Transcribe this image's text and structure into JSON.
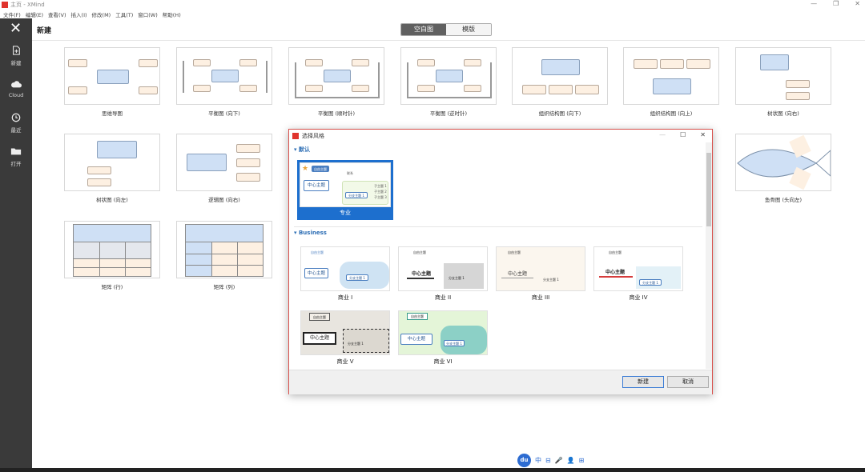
{
  "window": {
    "title": "主页 - XMind",
    "controls": [
      "—",
      "❐",
      "✕"
    ]
  },
  "menu": [
    "文件(F)",
    "编辑(E)",
    "查看(V)",
    "插入(I)",
    "修改(M)",
    "工具(T)",
    "窗口(W)",
    "帮助(H)"
  ],
  "sidebar": {
    "close": "✕",
    "items": [
      {
        "label": "新建",
        "icon": "new-file-icon"
      },
      {
        "label": "Cloud",
        "icon": "cloud-icon"
      },
      {
        "label": "最近",
        "icon": "clock-icon"
      },
      {
        "label": "打开",
        "icon": "folder-icon"
      }
    ]
  },
  "header": {
    "title": "新建",
    "tabs": [
      "空白图",
      "模版"
    ],
    "active_tab": 0
  },
  "templates": [
    "思维导图",
    "平衡图 (向下)",
    "平衡图 (顺时针)",
    "平衡图 (逆时针)",
    "组织结构图 (向下)",
    "组织结构图 (向上)",
    "树状图 (向右)",
    "树状图 (向左)",
    "逻辑图 (向右)",
    "鱼骨图 (头向左)",
    "矩阵 (行)",
    "矩阵 (列)"
  ],
  "dialog": {
    "title": "选择风格",
    "controls": [
      "—",
      "☐",
      "✕"
    ],
    "section_default": "默认",
    "section_business": "Business",
    "default_style": {
      "name": "专业",
      "center": "中心主题",
      "float": "自由主题",
      "branch": "分支主题 1",
      "subs": [
        "子主题 1",
        "子主题 2",
        "子主题 3"
      ],
      "rel": "联系"
    },
    "business_styles": [
      "商业 I",
      "商业 II",
      "商业 III",
      "商业 IV",
      "商业 V",
      "商业 VI"
    ],
    "thumb_text": {
      "center": "中心主题",
      "float": "自由主题",
      "branch": "分支主题 1",
      "sub": "子主题 1",
      "rel": "联系"
    },
    "buttons": {
      "ok": "新建",
      "cancel": "取消"
    }
  },
  "ime": {
    "logo": "du",
    "items": [
      "中",
      "⊟",
      "🎤",
      "👤",
      "⊞"
    ]
  },
  "colors": {
    "sidebar": "#3a3a3a",
    "accent": "#1d6fce",
    "dialog_border": "#d9534f",
    "tab_active": "#606060"
  }
}
